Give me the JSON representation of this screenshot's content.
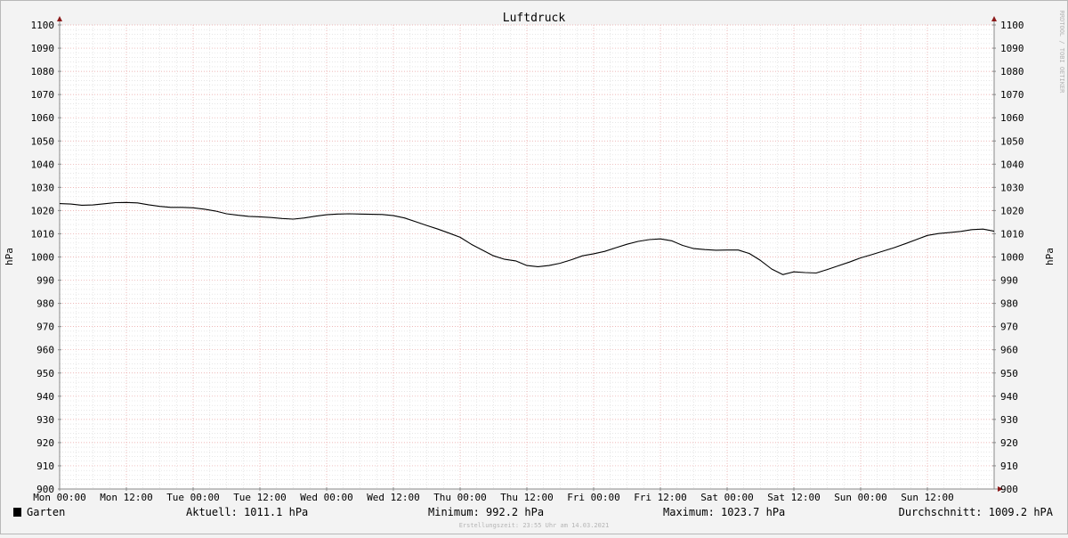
{
  "chart_data": {
    "type": "line",
    "title": "Luftdruck",
    "ylabel_left": "hPa",
    "ylabel_right": "hPa",
    "ylim": [
      900,
      1100
    ],
    "yticks": [
      900,
      910,
      920,
      930,
      940,
      950,
      960,
      970,
      980,
      990,
      1000,
      1010,
      1020,
      1030,
      1040,
      1050,
      1060,
      1070,
      1080,
      1090,
      1100
    ],
    "xlim": [
      0,
      168
    ],
    "xticks": [
      {
        "h": 0,
        "label": "Mon 00:00"
      },
      {
        "h": 12,
        "label": "Mon 12:00"
      },
      {
        "h": 24,
        "label": "Tue 00:00"
      },
      {
        "h": 36,
        "label": "Tue 12:00"
      },
      {
        "h": 48,
        "label": "Wed 00:00"
      },
      {
        "h": 60,
        "label": "Wed 12:00"
      },
      {
        "h": 72,
        "label": "Thu 00:00"
      },
      {
        "h": 84,
        "label": "Thu 12:00"
      },
      {
        "h": 96,
        "label": "Fri 00:00"
      },
      {
        "h": 108,
        "label": "Fri 12:00"
      },
      {
        "h": 120,
        "label": "Sat 00:00"
      },
      {
        "h": 132,
        "label": "Sat 12:00"
      },
      {
        "h": 144,
        "label": "Sun 00:00"
      },
      {
        "h": 156,
        "label": "Sun 12:00"
      }
    ],
    "grid": true,
    "series": [
      {
        "name": "Garten",
        "color": "#000000",
        "x": [
          0,
          2,
          4,
          6,
          8,
          10,
          12,
          14,
          16,
          18,
          20,
          22,
          24,
          26,
          28,
          30,
          32,
          34,
          36,
          38,
          40,
          42,
          44,
          46,
          48,
          50,
          52,
          54,
          56,
          58,
          60,
          62,
          64,
          66,
          68,
          70,
          72,
          74,
          76,
          78,
          80,
          82,
          84,
          86,
          88,
          90,
          92,
          94,
          96,
          98,
          100,
          102,
          104,
          106,
          108,
          110,
          112,
          114,
          116,
          118,
          120,
          122,
          124,
          126,
          128,
          130,
          132,
          134,
          136,
          138,
          140,
          142,
          144,
          146,
          148,
          150,
          152,
          154,
          156,
          158,
          160,
          162,
          164,
          166,
          168
        ],
        "y": [
          1023.0,
          1022.8,
          1022.3,
          1022.4,
          1022.9,
          1023.4,
          1023.5,
          1023.3,
          1022.5,
          1021.8,
          1021.4,
          1021.4,
          1021.2,
          1020.6,
          1019.8,
          1018.6,
          1018.0,
          1017.5,
          1017.3,
          1017.0,
          1016.6,
          1016.3,
          1016.8,
          1017.6,
          1018.2,
          1018.5,
          1018.6,
          1018.5,
          1018.4,
          1018.3,
          1017.8,
          1016.8,
          1015.2,
          1013.6,
          1012.0,
          1010.3,
          1008.5,
          1005.5,
          1003.0,
          1000.5,
          999.0,
          998.3,
          996.3,
          995.8,
          996.3,
          997.3,
          998.8,
          1000.5,
          1001.4,
          1002.4,
          1004.0,
          1005.5,
          1006.7,
          1007.5,
          1007.8,
          1007.0,
          1005.0,
          1003.6,
          1003.2,
          1002.9,
          1003.0,
          1003.0,
          1001.5,
          998.5,
          994.8,
          992.4,
          993.6,
          993.3,
          993.1,
          994.6,
          996.2,
          997.8,
          999.6,
          1001.0,
          1002.5,
          1004.0,
          1005.7,
          1007.5,
          1009.3,
          1010.1,
          1010.5,
          1011.0,
          1011.8,
          1012.0,
          1011.1
        ]
      }
    ]
  },
  "legend": {
    "series_name": "Garten",
    "swatch_color": "#000000",
    "stats": {
      "current": "Aktuell: 1011.1 hPa",
      "minimum": "Minimum: 992.2 hPa",
      "maximum": "Maximum: 1023.7 hPa",
      "average": "Durchschnitt: 1009.2 hPA"
    }
  },
  "footer": {
    "creation_time": "Erstellungszeit: 23:55 Uhr am 14.03.2021"
  },
  "watermark": "RRDTOOL / TOBI OETIKER",
  "colors": {
    "background": "#f3f3f3",
    "plot_background": "#ffffff",
    "major_grid": "#e8a0a0",
    "minor_grid": "#d8d8d8",
    "axis": "#888888",
    "arrow": "#8b1a1a"
  }
}
